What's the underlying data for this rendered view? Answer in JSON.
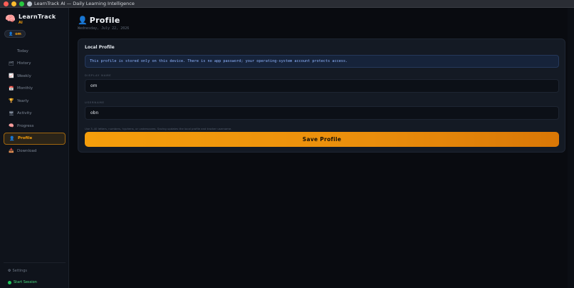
{
  "window": {
    "title": "LearnTrack AI — Daily Learning Intelligence"
  },
  "brand": {
    "icon": "🧠",
    "name": "LearnTrack",
    "sub": "AI"
  },
  "user_chip": {
    "icon": "👤",
    "label": "om"
  },
  "sidebar": {
    "items": [
      {
        "label": "Today",
        "icon": "",
        "active": false
      },
      {
        "label": "History",
        "icon": "🗂",
        "active": false
      },
      {
        "label": "Weekly",
        "icon": "📈",
        "active": false
      },
      {
        "label": "Monthly",
        "icon": "📅",
        "active": false
      },
      {
        "label": "Yearly",
        "icon": "🏆",
        "active": false
      },
      {
        "label": "Activity",
        "icon": "🖥",
        "active": false
      },
      {
        "label": "Progress",
        "icon": "🧠",
        "active": false
      },
      {
        "label": "Profile",
        "icon": "👤",
        "active": true
      },
      {
        "label": "Download",
        "icon": "📥",
        "active": false
      }
    ],
    "settings_label": "Settings",
    "settings_icon": "⚙",
    "start_session_label": "Start Session"
  },
  "page": {
    "icon": "👤",
    "title": "Profile",
    "date": "Wednesday, July 22, 2026"
  },
  "card": {
    "title": "Local Profile",
    "info": "This profile is stored only on this device. There is no app password; your operating-system account protects access.",
    "display_name_label": "DISPLAY NAME",
    "display_name_value": "om",
    "username_label": "USERNAME",
    "username_value": "obn",
    "hint": "Use 3–40 letters, numbers, hyphens, or underscores. Saving updates the local profile and tracker username.",
    "save_label": "Save Profile"
  },
  "colors": {
    "accent": "#f59e0b",
    "background": "#090b10",
    "sidebar": "#0f131b",
    "card": "#141a24",
    "info_text": "#8fb4ff",
    "session_green": "#22c55e"
  }
}
